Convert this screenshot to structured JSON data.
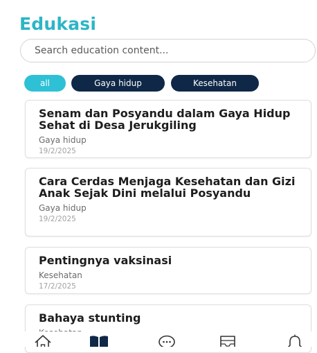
{
  "header": {
    "title": "Edukasi"
  },
  "search": {
    "placeholder": "Search education content..."
  },
  "filters": [
    {
      "label": "all",
      "active": true
    },
    {
      "label": "Gaya hidup",
      "active": false
    },
    {
      "label": "Kesehatan",
      "active": false
    }
  ],
  "articles": [
    {
      "title": "Senam dan Posyandu dalam Gaya Hidup Sehat di Desa Jerukgiling",
      "category": "Gaya hidup",
      "date": "19/2/2025"
    },
    {
      "title": "Cara Cerdas Menjaga Kesehatan dan Gizi Anak Sejak Dini melalui Posyandu",
      "category": "Gaya hidup",
      "date": "19/2/2025"
    },
    {
      "title": "Pentingnya vaksinasi",
      "category": "Kesehatan",
      "date": "17/2/2025"
    },
    {
      "title": "Bahaya stunting",
      "category": "Kesehatan",
      "date": ""
    }
  ],
  "bottom_nav": [
    {
      "icon": "home-icon",
      "active": false
    },
    {
      "icon": "book-icon",
      "active": true
    },
    {
      "icon": "chat-icon",
      "active": false
    },
    {
      "icon": "inbox-icon",
      "active": false
    },
    {
      "icon": "bell-icon",
      "active": false
    }
  ],
  "colors": {
    "accent": "#2bb6c6",
    "chip_active": "#2ec0d5",
    "chip_dark": "#0f2847"
  }
}
